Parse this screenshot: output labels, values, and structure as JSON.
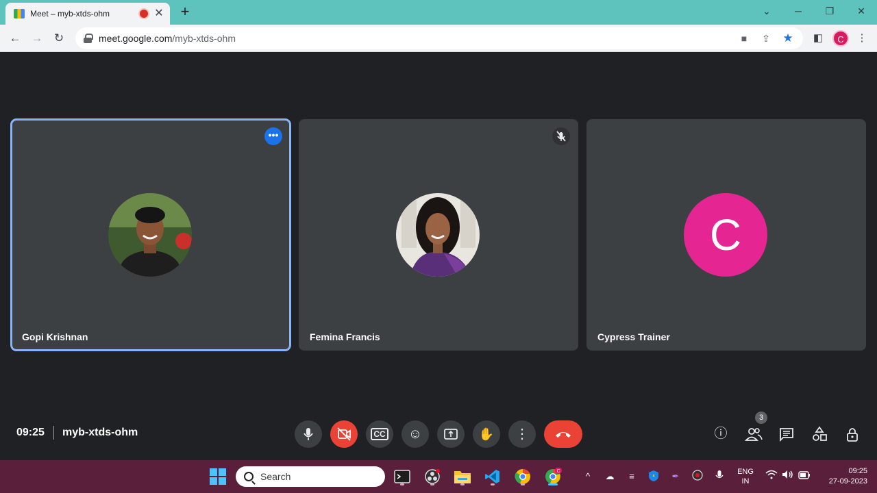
{
  "browser": {
    "tab_title": "Meet – myb-xtds-ohm",
    "url_host": "meet.google.com",
    "url_path": "/myb-xtds-ohm",
    "profile_initial": "C"
  },
  "meeting": {
    "time": "09:25",
    "code": "myb-xtds-ohm",
    "participant_count": "3"
  },
  "participants": [
    {
      "name": "Gopi Krishnan",
      "active": true,
      "muted": false
    },
    {
      "name": "Femina Francis",
      "active": false,
      "muted": true
    },
    {
      "name": "Cypress Trainer",
      "active": false,
      "muted": false,
      "initial": "C"
    }
  ],
  "taskbar": {
    "search_label": "Search",
    "lang_top": "ENG",
    "lang_bottom": "IN",
    "time": "09:25",
    "date": "27-09-2023"
  }
}
